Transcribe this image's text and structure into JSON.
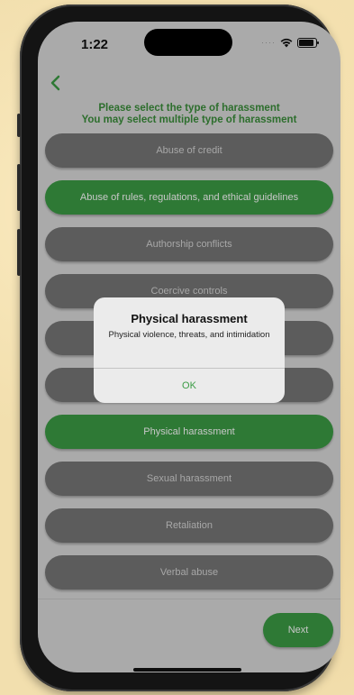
{
  "status": {
    "time": "1:22"
  },
  "heading": {
    "line1": "Please select the type of harassment",
    "line2": "You may select multiple type of harassment"
  },
  "options": [
    {
      "label": "Abuse of credit",
      "selected": false
    },
    {
      "label": "Abuse of rules, regulations, and ethical guidelines",
      "selected": true
    },
    {
      "label": "Authorship conflicts",
      "selected": false
    },
    {
      "label": "Coercive controls",
      "selected": false
    },
    {
      "label": "",
      "selected": false
    },
    {
      "label": "",
      "selected": false
    },
    {
      "label": "Physical harassment",
      "selected": true
    },
    {
      "label": "Sexual harassment",
      "selected": false
    },
    {
      "label": "Retaliation",
      "selected": false
    },
    {
      "label": "Verbal abuse",
      "selected": false
    }
  ],
  "next_label": "Next",
  "alert": {
    "title": "Physical harassment",
    "message": "Physical violence, threats, and intimidation",
    "ok_label": "OK"
  },
  "colors": {
    "accent": "#3b9c45",
    "option_unselected": "#777777",
    "heading": "#3a8e3a"
  },
  "icons": {
    "back": "chevron-left-icon",
    "wifi": "wifi-icon",
    "battery": "battery-icon"
  }
}
